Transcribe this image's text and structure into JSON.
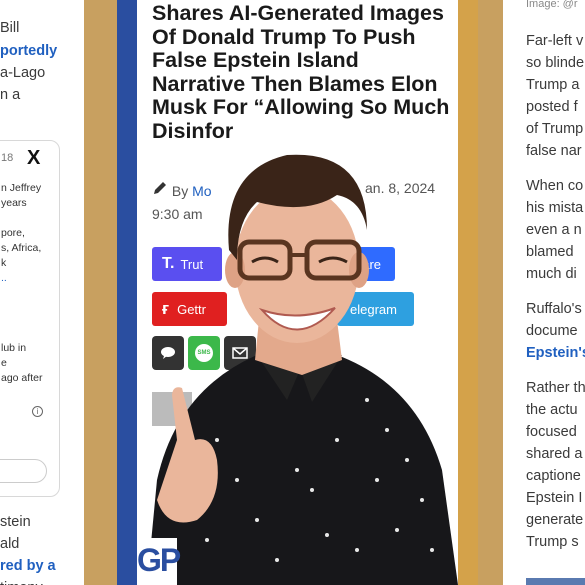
{
  "left_panel": {
    "lines": [
      "Bill",
      "portedly",
      "a-Lago",
      "n a"
    ],
    "tweet": {
      "date": "18",
      "x_logo": "X",
      "lines": [
        "n Jeffrey",
        "years",
        "pore,",
        "s, Africa,",
        "k",
        "..",
        "lub in",
        "e",
        "ago after"
      ]
    },
    "bottom_lines": [
      "stein",
      "ald",
      "red by a",
      "timony"
    ]
  },
  "article": {
    "headline": "Shares AI-Generated Images Of Donald Trump To Push False Epstein Island Narrative Then Blames Elon Musk For “Allowing So Much Disinfor",
    "byline_prefix": "By",
    "author_fragment": "Mo",
    "date_fragment": "an. 8, 2024",
    "time_fragment": "9:30 am",
    "share_buttons": {
      "truth": "Trut",
      "share": "hare",
      "gettr": "Gettr",
      "telegram": "elegram"
    },
    "share_icons": [
      "speech-bubble-icon",
      "sms-icon",
      "email-icon"
    ],
    "brand_mark": "GP",
    "colors": {
      "frame_left": "#2a4ea0",
      "frame_right": "#d4a24a",
      "truth": "#5a4ff0",
      "share": "#2f6bff",
      "gettr": "#e02020",
      "telegram": "#2ea0e0",
      "sms": "#3cb84a",
      "speech": "#333333"
    }
  },
  "right_panel": {
    "caption": "Image: @r",
    "lines": [
      "Far-left v",
      "so blinde",
      "Trump a",
      "posted f",
      "of Trump",
      "false nar",
      "When co",
      "his mista",
      "even a n",
      "blamed",
      "much di",
      "Ruffalo's",
      "docume",
      "Epstein's",
      "Rather th",
      "the actu",
      "focused",
      "shared a",
      "captione",
      "Epstein I",
      "generate",
      "Trump s"
    ]
  }
}
